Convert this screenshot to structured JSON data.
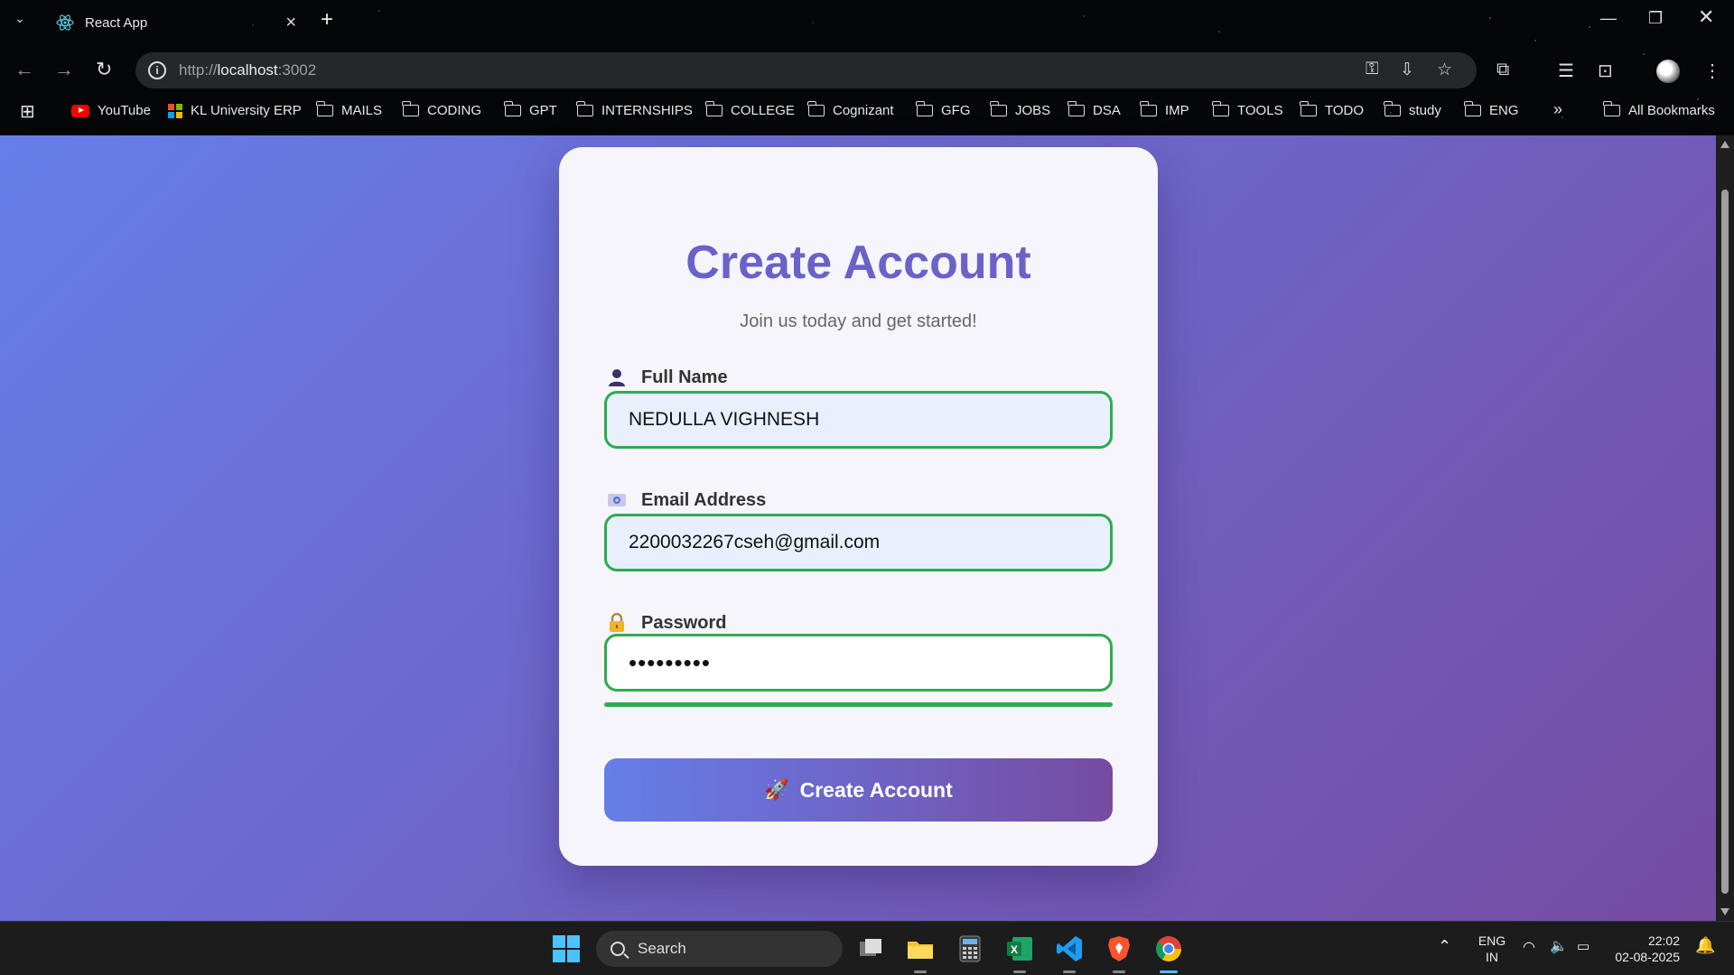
{
  "browser": {
    "tab_title": "React App",
    "url_scheme": "http://",
    "url_host": "localhost",
    "url_port": ":3002",
    "bookmarks": [
      {
        "label": "YouTube",
        "icon": "youtube-icon"
      },
      {
        "label": "KL University ERP",
        "icon": "microsoft-icon"
      },
      {
        "label": "MAILS",
        "icon": "folder-icon"
      },
      {
        "label": "CODING",
        "icon": "folder-icon"
      },
      {
        "label": "GPT",
        "icon": "folder-icon"
      },
      {
        "label": "INTERNSHIPS",
        "icon": "folder-icon"
      },
      {
        "label": "COLLEGE",
        "icon": "folder-icon"
      },
      {
        "label": "Cognizant",
        "icon": "folder-icon"
      },
      {
        "label": "GFG",
        "icon": "folder-icon"
      },
      {
        "label": "JOBS",
        "icon": "folder-icon"
      },
      {
        "label": "DSA",
        "icon": "folder-icon"
      },
      {
        "label": "IMP",
        "icon": "folder-icon"
      },
      {
        "label": "TOOLS",
        "icon": "folder-icon"
      },
      {
        "label": "TODO",
        "icon": "folder-icon"
      },
      {
        "label": "study",
        "icon": "folder-icon"
      },
      {
        "label": "ENG",
        "icon": "folder-icon"
      }
    ],
    "more_bookmarks": "»",
    "all_bookmarks": "All Bookmarks"
  },
  "form": {
    "title": "Create Account",
    "subtitle": "Join us today and get started!",
    "name_label": "Full Name",
    "name_value": "NEDULLA VIGHNESH",
    "email_label": "Email Address",
    "email_value": "2200032267cseh@gmail.com",
    "password_label": "Password",
    "password_value": "•••••••••",
    "password_strength": 1.0,
    "submit_label": "Create Account",
    "accent_color": "#6a62c9",
    "valid_color": "#2eab4f"
  },
  "taskbar": {
    "search_placeholder": "Search",
    "language_line1": "ENG",
    "language_line2": "IN",
    "time": "22:02",
    "date": "02-08-2025"
  }
}
